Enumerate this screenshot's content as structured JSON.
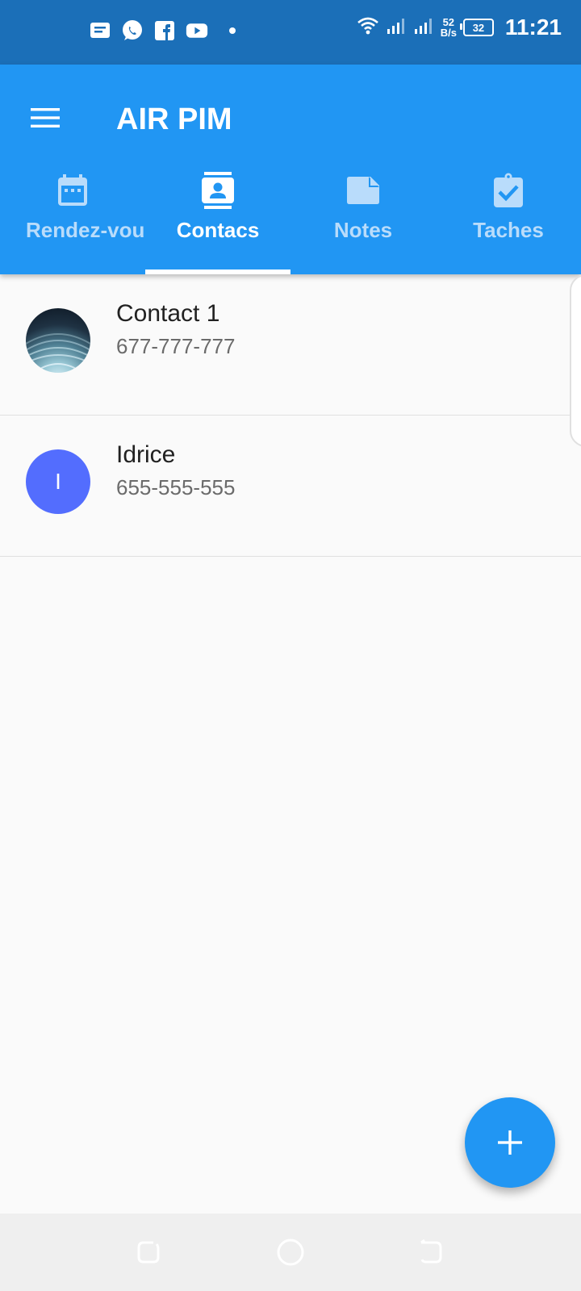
{
  "status_bar": {
    "left_icons": [
      "message-icon",
      "whatsapp-icon",
      "facebook-icon",
      "youtube-icon",
      "notification-dot"
    ],
    "net_speed_value": "52",
    "net_speed_unit": "B/s",
    "battery": "32",
    "time": "11:21"
  },
  "app_bar": {
    "title": "AIR PIM",
    "menu_icon": "hamburger-menu-icon",
    "color": "#2196f3"
  },
  "tabs": [
    {
      "label": "Rendez-vous",
      "icon": "calendar-icon",
      "active": false
    },
    {
      "label": "Contacs",
      "icon": "contact-card-icon",
      "active": true
    },
    {
      "label": "Notes",
      "icon": "note-icon",
      "active": false
    },
    {
      "label": "Taches",
      "icon": "task-clipboard-icon",
      "active": false
    }
  ],
  "contacts": [
    {
      "name": "Contact 1",
      "phone": "677-777-777",
      "avatar": "photo"
    },
    {
      "name": "Idrice",
      "phone": "655-555-555",
      "avatar_letter": "I",
      "avatar_color": "#536dfe"
    }
  ],
  "fab": {
    "icon": "plus-icon",
    "color": "#2196f3"
  },
  "nav_bar": {
    "buttons": [
      "recent-apps-icon",
      "home-icon",
      "back-icon"
    ]
  }
}
